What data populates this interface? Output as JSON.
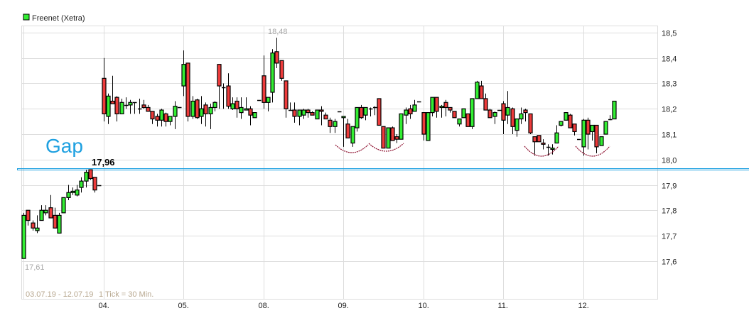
{
  "chart_data": {
    "type": "candlestick",
    "legend": {
      "label": "Freenet (Xetra)",
      "color": "#33ee33",
      "placement": "top-left"
    },
    "ylim": [
      17.47,
      18.53
    ],
    "yticks": [
      "18,5",
      "18,4",
      "18,3",
      "18,2",
      "18,1",
      "18,0",
      "17,9",
      "17,8",
      "17,7",
      "17,6"
    ],
    "ytick_values": [
      18.5,
      18.4,
      18.3,
      18.2,
      18.1,
      18.0,
      17.9,
      17.8,
      17.7,
      17.6
    ],
    "x_labels": [
      "04.",
      "05.",
      "08.",
      "09.",
      "10.",
      "11.",
      "12."
    ],
    "candles_per_day": 18,
    "colors": {
      "up": "#33ee33",
      "down": "#ee3b3b",
      "gap_line": "#1ea0e0",
      "annotation": "#8b0a2a",
      "grid": "#dddddd"
    },
    "date_range": "03.07.19 - 12.07.19",
    "tick_info": "1 Tick = 30 Min.",
    "max_label": "18,48",
    "min_label": "17,61",
    "gap_text": "Gap",
    "gap_level": 17.96,
    "gap_level_label": "17,96",
    "days": [
      {
        "date": "03.07.",
        "candles": [
          [
            17.61,
            17.79,
            17.61,
            17.78
          ],
          [
            17.8,
            17.8,
            17.74,
            17.76
          ],
          [
            17.75,
            17.76,
            17.72,
            17.73
          ],
          [
            17.72,
            17.78,
            17.71,
            17.73
          ],
          [
            17.76,
            17.82,
            17.76,
            17.8
          ],
          [
            17.79,
            17.82,
            17.78,
            17.8
          ],
          [
            17.81,
            17.86,
            17.77,
            17.77
          ],
          [
            17.78,
            17.81,
            17.73,
            17.73
          ],
          [
            17.71,
            17.79,
            17.71,
            17.78
          ],
          [
            17.79,
            17.85,
            17.79,
            17.85
          ],
          [
            17.85,
            17.9,
            17.84,
            17.87
          ],
          [
            17.87,
            17.89,
            17.86,
            17.875
          ],
          [
            17.86,
            17.9,
            17.855,
            17.88
          ],
          [
            17.89,
            17.93,
            17.87,
            17.915
          ],
          [
            17.915,
            17.96,
            17.89,
            17.95
          ],
          [
            17.96,
            17.96,
            17.92,
            17.925
          ],
          [
            17.93,
            17.93,
            17.87,
            17.88
          ],
          [
            17.9,
            17.9,
            17.9,
            17.9
          ]
        ]
      },
      {
        "date": "04.07.",
        "candles": [
          [
            18.32,
            18.4,
            18.15,
            18.18
          ],
          [
            18.17,
            18.26,
            18.14,
            18.25
          ],
          [
            18.23,
            18.33,
            18.22,
            18.22
          ],
          [
            18.245,
            18.25,
            18.15,
            18.18
          ],
          [
            18.18,
            18.24,
            18.18,
            18.225
          ],
          [
            18.215,
            18.245,
            18.2,
            18.215
          ],
          [
            18.215,
            18.235,
            18.18,
            18.225
          ],
          [
            18.225,
            18.225,
            18.18,
            18.225
          ],
          [
            18.2,
            18.24,
            18.18,
            18.2
          ],
          [
            18.215,
            18.235,
            18.2,
            18.205
          ],
          [
            18.205,
            18.215,
            18.19,
            18.19
          ],
          [
            18.19,
            18.19,
            18.14,
            18.16
          ],
          [
            18.17,
            18.18,
            18.13,
            18.155
          ],
          [
            18.155,
            18.2,
            18.13,
            18.195
          ],
          [
            18.18,
            18.185,
            18.13,
            18.15
          ],
          [
            18.15,
            18.17,
            18.135,
            18.17
          ],
          [
            18.17,
            18.23,
            18.12,
            18.21
          ],
          [
            18.205,
            18.205,
            18.205,
            18.205
          ]
        ]
      },
      {
        "date": "05.07.",
        "candles": [
          [
            18.29,
            18.43,
            18.25,
            18.375
          ],
          [
            18.38,
            18.38,
            18.15,
            18.17
          ],
          [
            18.17,
            18.25,
            18.16,
            18.23
          ],
          [
            18.235,
            18.24,
            18.16,
            18.165
          ],
          [
            18.17,
            18.25,
            18.14,
            18.2
          ],
          [
            18.215,
            18.225,
            18.13,
            18.18
          ],
          [
            18.18,
            18.22,
            18.12,
            18.205
          ],
          [
            18.205,
            18.23,
            18.19,
            18.225
          ],
          [
            18.375,
            18.375,
            18.2,
            18.29
          ],
          [
            18.285,
            18.3,
            18.2,
            18.285
          ],
          [
            18.29,
            18.34,
            18.2,
            18.21
          ],
          [
            18.2,
            18.245,
            18.195,
            18.22
          ],
          [
            18.23,
            18.245,
            18.165,
            18.2
          ],
          [
            18.185,
            18.245,
            18.16,
            18.205
          ],
          [
            18.195,
            18.245,
            18.195,
            18.2
          ],
          [
            18.2,
            18.21,
            18.135,
            18.175
          ],
          [
            18.165,
            18.185,
            18.165,
            18.185
          ],
          [
            18.235,
            18.235,
            18.235,
            18.235
          ]
        ]
      },
      {
        "date": "08.07.",
        "candles": [
          [
            18.33,
            18.41,
            18.2,
            18.225
          ],
          [
            18.225,
            18.245,
            18.19,
            18.245
          ],
          [
            18.265,
            18.435,
            18.225,
            18.42
          ],
          [
            18.425,
            18.48,
            18.36,
            18.38
          ],
          [
            18.39,
            18.39,
            18.31,
            18.32
          ],
          [
            18.31,
            18.31,
            18.165,
            18.2
          ],
          [
            18.195,
            18.225,
            18.195,
            18.195
          ],
          [
            18.195,
            18.225,
            18.145,
            18.17
          ],
          [
            18.17,
            18.195,
            18.135,
            18.195
          ],
          [
            18.175,
            18.2,
            18.16,
            18.195
          ],
          [
            18.195,
            18.2,
            18.165,
            18.185
          ],
          [
            18.185,
            18.19,
            18.18,
            18.175
          ],
          [
            18.16,
            18.195,
            18.16,
            18.195
          ],
          [
            18.195,
            18.21,
            18.135,
            18.19
          ],
          [
            18.175,
            18.185,
            18.16,
            18.16
          ],
          [
            18.155,
            18.165,
            18.105,
            18.13
          ],
          [
            18.13,
            18.16,
            18.105,
            18.15
          ],
          [
            18.19,
            18.19,
            18.19,
            18.19
          ]
        ]
      },
      {
        "date": "09.07.",
        "candles": [
          [
            18.165,
            18.17,
            18.05,
            18.17
          ],
          [
            18.14,
            18.16,
            18.085,
            18.085
          ],
          [
            18.065,
            18.13,
            18.05,
            18.13
          ],
          [
            18.125,
            18.205,
            18.11,
            18.205
          ],
          [
            18.205,
            18.215,
            18.16,
            18.165
          ],
          [
            18.175,
            18.205,
            18.155,
            18.205
          ],
          [
            18.2,
            18.205,
            18.17,
            18.2
          ],
          [
            18.205,
            18.21,
            18.175,
            18.205
          ],
          [
            18.24,
            18.24,
            18.135,
            18.135
          ],
          [
            18.13,
            18.13,
            18.045,
            18.045
          ],
          [
            18.045,
            18.125,
            18.045,
            18.125
          ],
          [
            18.125,
            18.13,
            18.075,
            18.075
          ],
          [
            18.09,
            18.1,
            18.065,
            18.08
          ],
          [
            18.08,
            18.18,
            18.08,
            18.18
          ],
          [
            18.175,
            18.205,
            18.14,
            18.195
          ],
          [
            18.2,
            18.215,
            18.16,
            18.18
          ],
          [
            18.19,
            18.235,
            18.19,
            18.215
          ],
          [
            18.23,
            18.23,
            18.23,
            18.23
          ]
        ]
      },
      {
        "date": "10.07.",
        "candles": [
          [
            18.185,
            18.185,
            18.075,
            18.1
          ],
          [
            18.075,
            18.185,
            18.075,
            18.185
          ],
          [
            18.185,
            18.245,
            18.17,
            18.245
          ],
          [
            18.245,
            18.245,
            18.165,
            18.19
          ],
          [
            18.205,
            18.215,
            18.165,
            18.21
          ],
          [
            18.225,
            18.235,
            18.17,
            18.205
          ],
          [
            18.205,
            18.205,
            18.185,
            18.195
          ],
          [
            18.19,
            18.19,
            18.165,
            18.165
          ],
          [
            18.14,
            18.16,
            18.13,
            18.16
          ],
          [
            18.165,
            18.2,
            18.165,
            18.2
          ],
          [
            18.18,
            18.18,
            18.13,
            18.13
          ],
          [
            18.13,
            18.24,
            18.12,
            18.24
          ],
          [
            18.24,
            18.31,
            18.24,
            18.305
          ],
          [
            18.29,
            18.31,
            18.24,
            18.24
          ],
          [
            18.24,
            18.26,
            18.195,
            18.195
          ],
          [
            18.195,
            18.2,
            18.165,
            18.165
          ],
          [
            18.17,
            18.19,
            18.14,
            18.185
          ],
          [
            18.195,
            18.195,
            18.195,
            18.195
          ]
        ]
      },
      {
        "date": "11.07.",
        "candles": [
          [
            18.22,
            18.23,
            18.1,
            18.155
          ],
          [
            18.175,
            18.27,
            18.14,
            18.205
          ],
          [
            18.2,
            18.205,
            18.1,
            18.13
          ],
          [
            18.115,
            18.16,
            18.09,
            18.16
          ],
          [
            18.16,
            18.205,
            18.14,
            18.18
          ],
          [
            18.195,
            18.2,
            18.15,
            18.185
          ],
          [
            18.18,
            18.18,
            18.1,
            18.105
          ],
          [
            18.09,
            18.09,
            18.015,
            18.07
          ],
          [
            18.095,
            18.095,
            18.07,
            18.07
          ],
          [
            18.065,
            18.08,
            18.04,
            18.06
          ],
          [
            18.05,
            18.06,
            18.015,
            18.05
          ],
          [
            18.04,
            18.06,
            18.02,
            18.045
          ],
          [
            18.065,
            18.135,
            18.065,
            18.105
          ],
          [
            18.135,
            18.15,
            18.13,
            18.15
          ],
          [
            18.155,
            18.185,
            18.155,
            18.185
          ],
          [
            18.175,
            18.18,
            18.125,
            18.125
          ],
          [
            18.14,
            18.14,
            18.095,
            18.11
          ],
          [
            18.08,
            18.08,
            18.08,
            18.08
          ]
        ]
      },
      {
        "date": "12.07.",
        "candles": [
          [
            18.05,
            18.16,
            18.015,
            18.155
          ],
          [
            18.155,
            18.165,
            18.04,
            18.1
          ],
          [
            18.11,
            18.13,
            18.075,
            18.135
          ],
          [
            18.135,
            18.135,
            18.025,
            18.05
          ],
          [
            18.055,
            18.09,
            18.055,
            18.09
          ],
          [
            18.1,
            18.15,
            18.1,
            18.15
          ],
          [
            18.16,
            18.175,
            18.155,
            18.16
          ],
          [
            18.16,
            18.23,
            18.16,
            18.23
          ]
        ]
      }
    ]
  }
}
